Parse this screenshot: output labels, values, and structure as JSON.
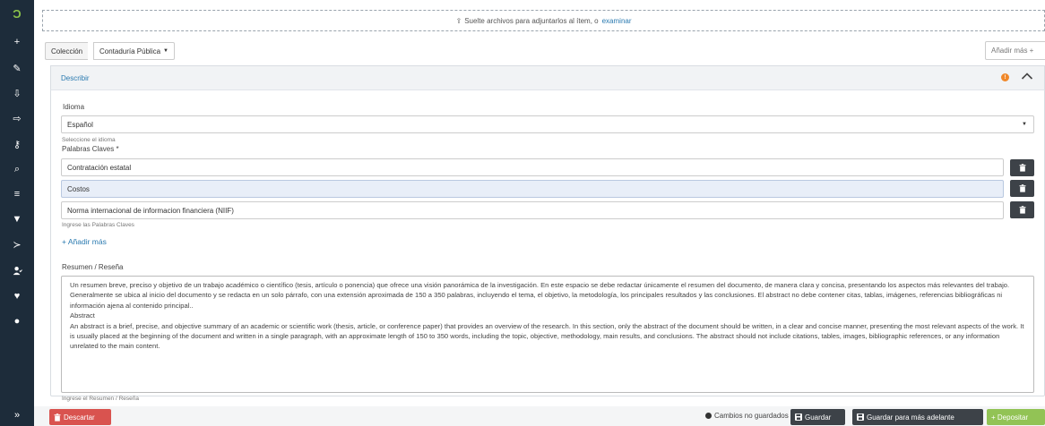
{
  "sidebar": {
    "logo": "Ɔ",
    "icons": [
      "plus-icon",
      "pencil-icon",
      "import-icon",
      "export-icon",
      "key-icon",
      "search-icon",
      "list-icon",
      "filter-icon",
      "terminal-icon",
      "user-check-icon",
      "heartbeat-icon",
      "info-icon",
      "expand-icon"
    ],
    "glyphs": [
      "+",
      "✎",
      "⇩",
      "⇨",
      "⚷",
      "⌕",
      "≡",
      "▼",
      "≻",
      "👤",
      "♥",
      "●",
      "»"
    ]
  },
  "dropzone": {
    "text": "Suelte archivos para adjuntarlos al ítem, o",
    "link": "examinar",
    "icon": "upload-icon"
  },
  "collection": {
    "label": "Colección",
    "value": "Contaduría Pública",
    "add_more": "Añadir más +"
  },
  "panel": {
    "title": "Describir",
    "warning_glyph": "!",
    "collapse_glyph": "^"
  },
  "idioma": {
    "label": "Idioma",
    "value": "Español",
    "hint": "Seleccione el idioma"
  },
  "keywords": {
    "label": "Palabras Claves *",
    "items": [
      "Contratación estatal",
      "Costos",
      "Norma internacional de informacion financiera (NIIF)"
    ],
    "hint": "Ingrese las Palabras Claves",
    "add_more": "+ Añadir más"
  },
  "abstract": {
    "label": "Resumen / Reseña",
    "text": "Un resumen breve, preciso y objetivo de un trabajo académico o científico (tesis, artículo o ponencia) que ofrece una visión panorámica de la investigación. En este espacio se debe redactar únicamente el resumen del documento, de manera clara y concisa, presentando los aspectos más relevantes del trabajo. Generalmente se ubica al inicio del documento y se redacta en un solo párrafo, con una extensión aproximada de 150 a 350 palabras, incluyendo el tema, el objetivo, la metodología, los principales resultados y las conclusiones. El abstract no debe contener citas, tablas, imágenes, referencias bibliográficas ni información ajena al contenido principal..\nAbstract\nAn abstract is a brief, precise, and objective summary of an academic or scientific work (thesis, article, or conference paper) that provides an overview of the research. In this section, only the abstract of the document should be written, in a clear and concise manner, presenting the most relevant aspects of the work. It is usually placed at the beginning of the document and written in a single paragraph, with an approximate length of 150 to 350 words, including the topic, objective, methodology, main results, and conclusions. The abstract should not include citations, tables, images, bibliographic references, or any information unrelated to the main content.",
    "hint": "Ingrese el Resumen / Reseña"
  },
  "footer": {
    "discard": "Descartar",
    "unsaved": "Cambios no guardados",
    "save": "Guardar",
    "save_later": "Guardar para más adelante",
    "deposit": "+ Depositar"
  }
}
